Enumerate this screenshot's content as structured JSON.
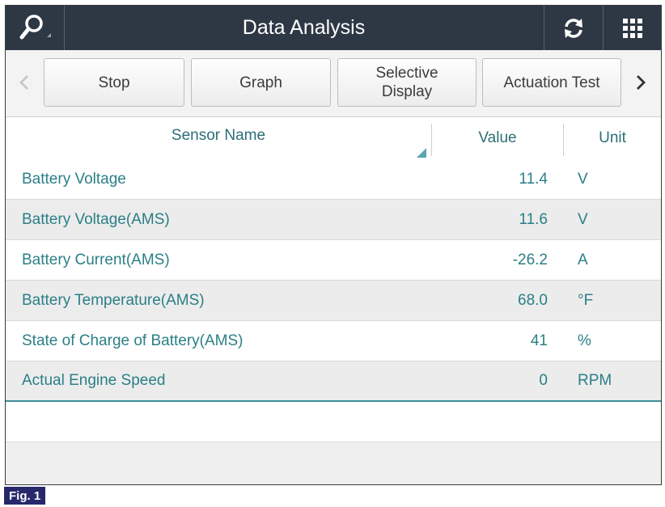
{
  "header": {
    "title": "Data Analysis",
    "icons": {
      "search": "search-icon",
      "refresh": "refresh-icon",
      "menu": "grid-menu-icon"
    }
  },
  "toolbar": {
    "stop_label": "Stop",
    "graph_label": "Graph",
    "selective_display_label": "Selective Display",
    "actuation_test_label": "Actuation Test"
  },
  "table": {
    "columns": {
      "sensor_name": "Sensor Name",
      "value": "Value",
      "unit": "Unit"
    },
    "rows": [
      {
        "name": "Battery Voltage",
        "value": "11.4",
        "unit": "V"
      },
      {
        "name": "Battery Voltage(AMS)",
        "value": "11.6",
        "unit": "V"
      },
      {
        "name": "Battery Current(AMS)",
        "value": "-26.2",
        "unit": "A"
      },
      {
        "name": "Battery Temperature(AMS)",
        "value": "68.0",
        "unit": "°F"
      },
      {
        "name": "State of Charge of Battery(AMS)",
        "value": "41",
        "unit": "%"
      },
      {
        "name": "Actual Engine Speed",
        "value": "0",
        "unit": "RPM"
      }
    ]
  },
  "figure_label": "Fig. 1",
  "colors": {
    "header_bg": "#2e3844",
    "accent_text": "#2b7f86",
    "figure_badge": "#27276b"
  }
}
